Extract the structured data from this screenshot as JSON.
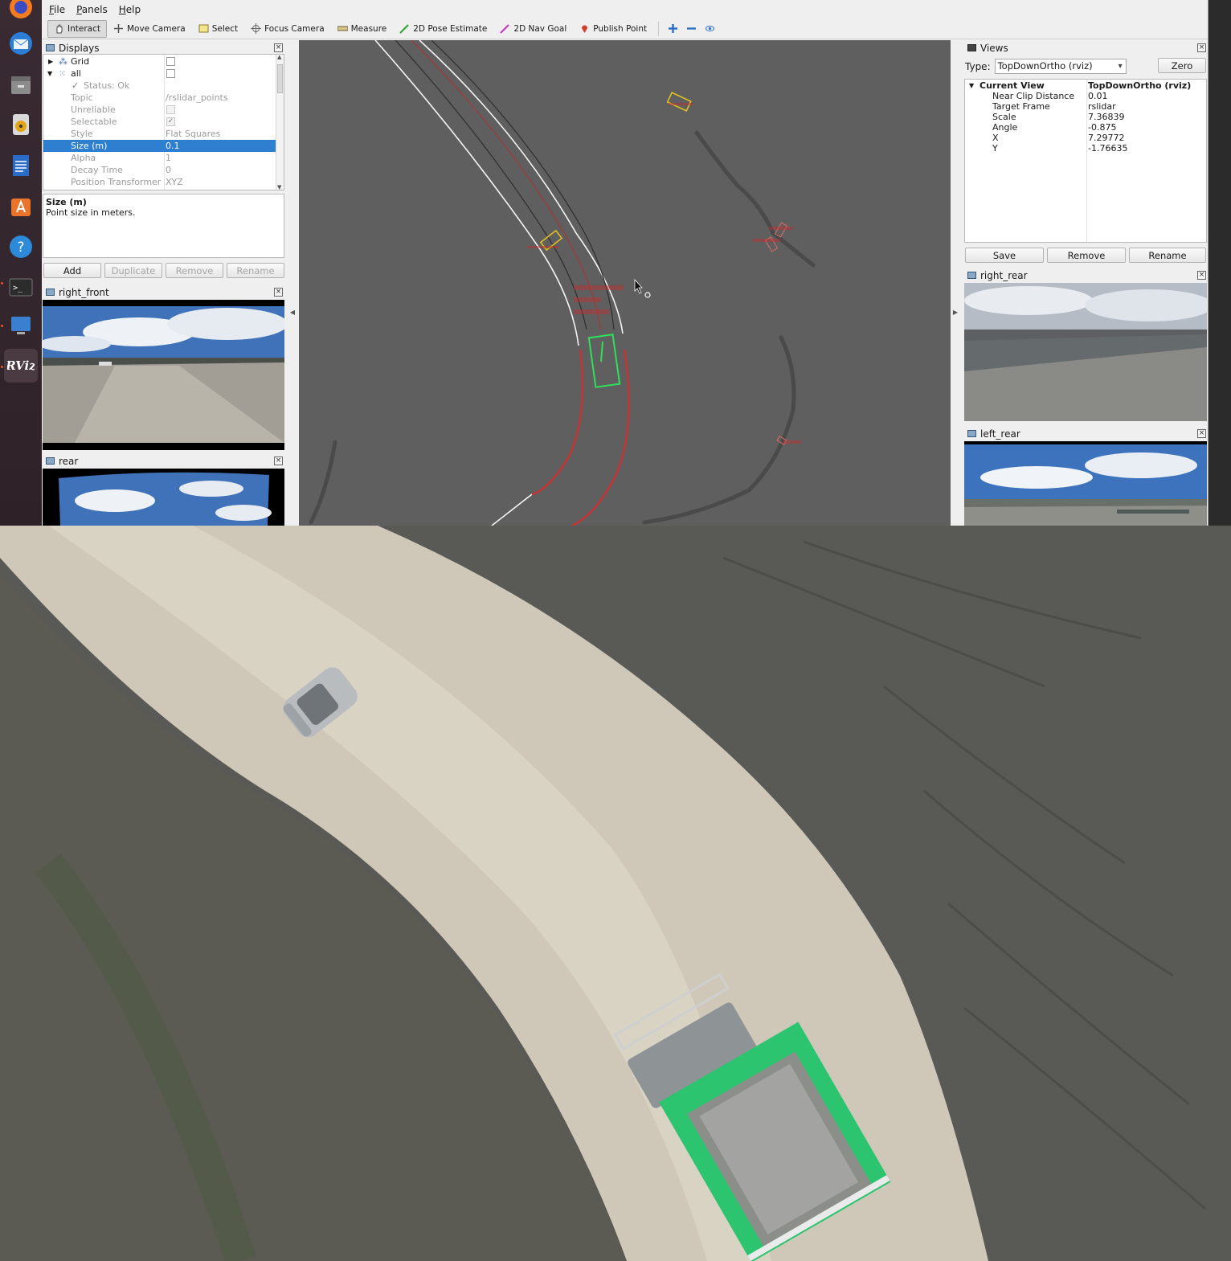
{
  "menubar": {
    "items": [
      "File",
      "Panels",
      "Help"
    ]
  },
  "toolbar": {
    "tools": [
      "Interact",
      "Move Camera",
      "Select",
      "Focus Camera",
      "Measure",
      "2D Pose Estimate",
      "2D Nav Goal",
      "Publish Point"
    ],
    "active": "Interact"
  },
  "displays": {
    "title": "Displays",
    "rows": [
      {
        "label": "Grid",
        "value": ""
      },
      {
        "label": "all",
        "value": ""
      },
      {
        "label": "Status: Ok",
        "value": ""
      },
      {
        "label": "Topic",
        "value": "/rslidar_points"
      },
      {
        "label": "Unreliable",
        "value": ""
      },
      {
        "label": "Selectable",
        "value": ""
      },
      {
        "label": "Style",
        "value": "Flat Squares"
      },
      {
        "label": "Size (m)",
        "value": "0.1"
      },
      {
        "label": "Alpha",
        "value": "1"
      },
      {
        "label": "Decay Time",
        "value": "0"
      },
      {
        "label": "Position Transformer",
        "value": "XYZ"
      }
    ],
    "description_title": "Size (m)",
    "description_text": "Point size in meters.",
    "buttons": [
      "Add",
      "Duplicate",
      "Remove",
      "Rename"
    ]
  },
  "cameras": {
    "right_front": "right_front",
    "rear": "rear",
    "right_rear": "right_rear",
    "left_rear": "left_rear"
  },
  "views": {
    "title": "Views",
    "type_label": "Type:",
    "type_value": "TopDownOrtho (rviz)",
    "zero_button": "Zero",
    "current_view": {
      "label": "Current View",
      "value": "TopDownOrtho (rviz)"
    },
    "properties": [
      {
        "label": "Near Clip Distance",
        "value": "0.01"
      },
      {
        "label": "Target Frame",
        "value": "rslidar"
      },
      {
        "label": "Scale",
        "value": "7.36839"
      },
      {
        "label": "Angle",
        "value": "-0.875"
      },
      {
        "label": "X",
        "value": "7.29772"
      },
      {
        "label": "Y",
        "value": "-1.76635"
      }
    ],
    "buttons": [
      "Save",
      "Remove",
      "Rename"
    ]
  },
  "colors": {
    "selection": "#2f7fd0",
    "viewport_bg": "#5f5f5f",
    "truck": "#21b36a",
    "path": "#d23030"
  },
  "dock_icons": [
    "firefox-icon",
    "thunderbird-icon",
    "files-icon",
    "rhythmbox-icon",
    "writer-icon",
    "software-icon",
    "help-icon",
    "terminal-icon",
    "remote-icon",
    "rviz-icon"
  ]
}
